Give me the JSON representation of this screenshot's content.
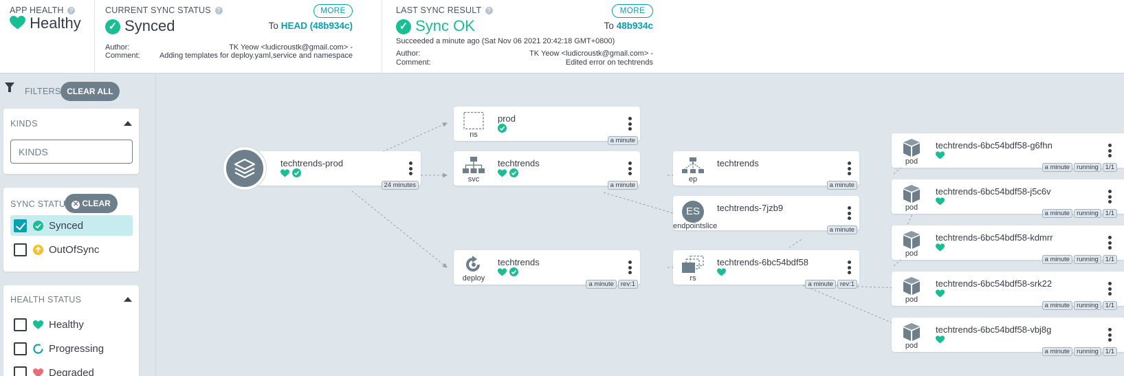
{
  "app_health": {
    "title": "APP HEALTH",
    "value": "Healthy",
    "help": "?"
  },
  "sync_status": {
    "title": "CURRENT SYNC STATUS",
    "value": "Synced",
    "more": "MORE",
    "to_prefix": "To",
    "to_ref": "HEAD (48b934c)",
    "author_label": "Author:",
    "author": "TK Yeow <ludicroustk@gmail.com> -",
    "comment_label": "Comment:",
    "comment": "Adding templates for deploy.yaml,service and namespace"
  },
  "last_sync": {
    "title": "LAST SYNC RESULT",
    "value": "Sync OK",
    "more": "MORE",
    "to_prefix": "To",
    "to_ref": "48b934c",
    "succeeded": "Succeeded a minute ago (Sat Nov 06 2021 20:42:18 GMT+0800)",
    "author_label": "Author:",
    "author": "TK Yeow <ludicroustk@gmail.com> -",
    "comment_label": "Comment:",
    "comment": "Edited error on techtrends"
  },
  "filters": {
    "label": "FILTERS",
    "clear_all": "CLEAR ALL",
    "kinds": {
      "title": "KINDS",
      "placeholder": "KINDS"
    },
    "sync_status": {
      "title": "SYNC STATUS",
      "clear": "CLEAR",
      "items": [
        {
          "label": "Synced",
          "checked": true
        },
        {
          "label": "OutOfSync",
          "checked": false
        }
      ]
    },
    "health_status": {
      "title": "HEALTH STATUS",
      "items": [
        {
          "label": "Healthy",
          "checked": false
        },
        {
          "label": "Progressing",
          "checked": false
        },
        {
          "label": "Degraded",
          "checked": false
        }
      ]
    }
  },
  "graph": {
    "nodes": {
      "app": {
        "name": "techtrends-prod",
        "tags": [
          "24 minutes"
        ]
      },
      "ns": {
        "kind": "ns",
        "name": "prod",
        "tags": [
          "a minute"
        ]
      },
      "svc": {
        "kind": "svc",
        "name": "techtrends",
        "tags": [
          "a minute"
        ]
      },
      "deploy": {
        "kind": "deploy",
        "name": "techtrends",
        "tags": [
          "a minute",
          "rev:1"
        ]
      },
      "ep": {
        "kind": "ep",
        "name": "techtrends",
        "tags": [
          "a minute"
        ]
      },
      "es": {
        "kind": "endpointslice",
        "name": "techtrends-7jzb9",
        "icon_text": "ES",
        "tags": [
          "a minute"
        ]
      },
      "rs": {
        "kind": "rs",
        "name": "techtrends-6bc54bdf58",
        "tags": [
          "a minute",
          "rev:1"
        ]
      },
      "pod1": {
        "kind": "pod",
        "name": "techtrends-6bc54bdf58-g6fhn",
        "tags": [
          "a minute",
          "running",
          "1/1"
        ]
      },
      "pod2": {
        "kind": "pod",
        "name": "techtrends-6bc54bdf58-j5c6v",
        "tags": [
          "a minute",
          "running",
          "1/1"
        ]
      },
      "pod3": {
        "kind": "pod",
        "name": "techtrends-6bc54bdf58-kdmrr",
        "tags": [
          "a minute",
          "running",
          "1/1"
        ]
      },
      "pod4": {
        "kind": "pod",
        "name": "techtrends-6bc54bdf58-srk22",
        "tags": [
          "a minute",
          "running",
          "1/1"
        ]
      },
      "pod5": {
        "kind": "pod",
        "name": "techtrends-6bc54bdf58-vbj8g",
        "tags": [
          "a minute",
          "running",
          "1/1"
        ]
      }
    }
  },
  "colors": {
    "healthy": "#18be94",
    "accent": "#00a2b3",
    "out_of_sync": "#f4c030",
    "degraded": "#e96d76"
  }
}
